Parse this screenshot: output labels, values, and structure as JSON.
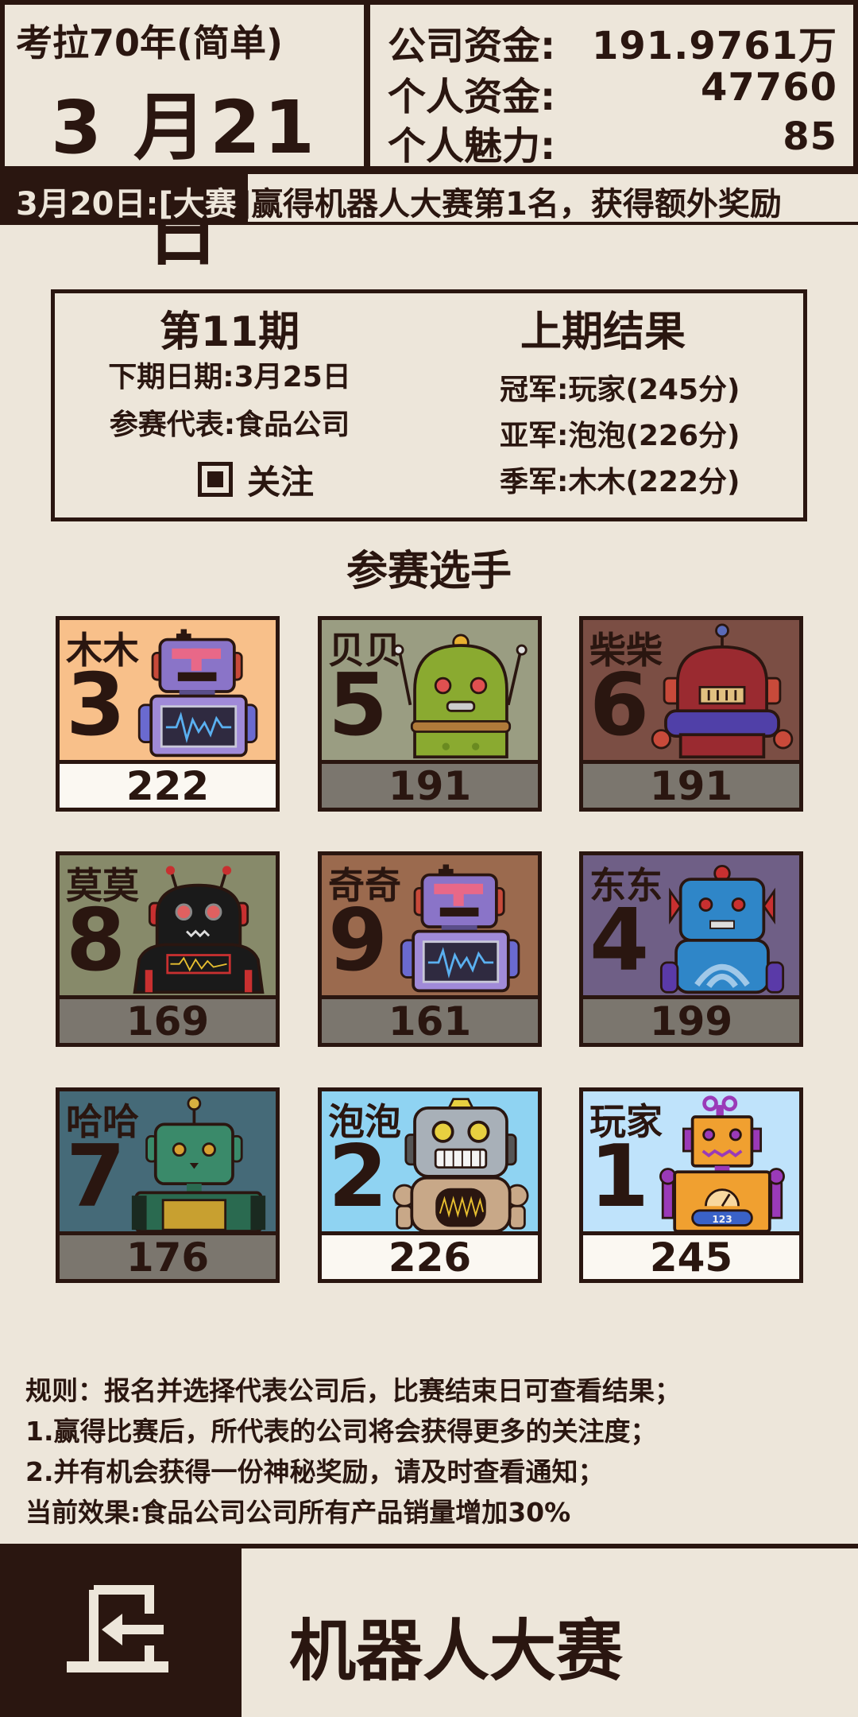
{
  "header": {
    "game_title": "考拉70年(简单)",
    "date": "3 月21 日",
    "funds": [
      {
        "label": "公司资金:",
        "value": "191.9761万"
      },
      {
        "label": "个人资金:",
        "value": "47760"
      },
      {
        "label": "个人魅力:",
        "value": "85"
      }
    ]
  },
  "ticker": {
    "prefix": "3月20日:[大赛",
    "text": "]赢得机器人大赛第1名，获得额外奖励"
  },
  "season": {
    "title": "第11期",
    "next_date": "下期日期:3月25日",
    "representative": "参赛代表:食品公司",
    "follow_label": "关注",
    "follow_checked": true,
    "last_title": "上期结果",
    "results": [
      "冠军:玩家(245分)",
      "亚军:泡泡(226分)",
      "季军:木木(222分)"
    ]
  },
  "players_heading": "参赛选手",
  "players": [
    {
      "name": "木木",
      "rank": "3",
      "score": "222",
      "bg": "#f8c08a",
      "score_style": "light",
      "robot": "purple-robot-icon"
    },
    {
      "name": "贝贝",
      "rank": "5",
      "score": "191",
      "bg": "#9a9d82",
      "score_style": "grey",
      "robot": "green-dome-robot-icon"
    },
    {
      "name": "柴柴",
      "rank": "6",
      "score": "191",
      "bg": "#7b4e44",
      "score_style": "grey",
      "robot": "red-dome-robot-icon"
    },
    {
      "name": "莫莫",
      "rank": "8",
      "score": "169",
      "bg": "#878a6a",
      "score_style": "grey",
      "robot": "black-robot-icon"
    },
    {
      "name": "奇奇",
      "rank": "9",
      "score": "161",
      "bg": "#9b6a4e",
      "score_style": "grey",
      "robot": "purple-robot-icon"
    },
    {
      "name": "东东",
      "rank": "4",
      "score": "199",
      "bg": "#6f5f86",
      "score_style": "grey",
      "robot": "blue-robot-icon"
    },
    {
      "name": "哈哈",
      "rank": "7",
      "score": "176",
      "bg": "#456a78",
      "score_style": "grey",
      "robot": "teal-robot-icon"
    },
    {
      "name": "泡泡",
      "rank": "2",
      "score": "226",
      "bg": "#8fd3f2",
      "score_style": "light",
      "robot": "silver-robot-icon"
    },
    {
      "name": "玩家",
      "rank": "1",
      "score": "245",
      "bg": "#bfe3fb",
      "score_style": "light",
      "robot": "orange-robot-icon"
    }
  ],
  "rules": [
    "规则：报名并选择代表公司后，比赛结束日可查看结果；",
    "1.赢得比赛后，所代表的公司将会获得更多的关注度；",
    "2.并有机会获得一份神秘奖励，请及时查看通知；",
    "当前效果:食品公司公司所有产品销量增加30%"
  ],
  "footer": {
    "title": "机器人大赛",
    "back_icon": "back-exit-icon"
  },
  "colors": {
    "dark": "#2a1610",
    "background": "#ede6da"
  }
}
